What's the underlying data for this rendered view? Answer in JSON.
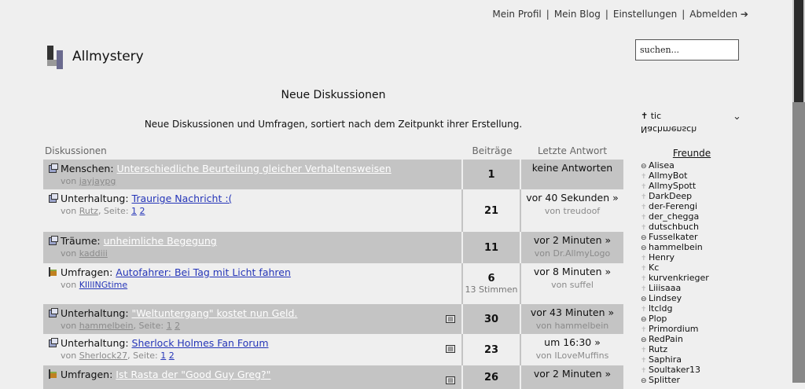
{
  "topnav": {
    "profile": "Mein Profil",
    "blog": "Mein Blog",
    "settings": "Einstellungen",
    "logout": "Abmelden ➔"
  },
  "logo": {
    "text": "Allmystery"
  },
  "search": {
    "value": "suchen..."
  },
  "page": {
    "title": "Neue Diskussionen",
    "description": "Neue Diskussionen und Umfragen, sortiert nach dem Zeitpunkt ihrer Erstellung."
  },
  "table": {
    "headers": {
      "discussions": "Diskussionen",
      "posts": "Beiträge",
      "last_reply": "Letzte Antwort"
    },
    "rows": [
      {
        "type": "topic",
        "category": "Menschen:",
        "title": "Unterschiedliche Beurteilung gleicher Verhaltensweisen",
        "by_prefix": "von",
        "author": "jayjaypg",
        "pages_label": "",
        "pages": [],
        "count": "1",
        "votes": "",
        "last": "keine Antworten",
        "last_by": ""
      },
      {
        "type": "topic",
        "category": "Unterhaltung:",
        "title": "Traurige Nachricht :(",
        "by_prefix": "von",
        "author": "Rutz",
        "pages_label": ", Seite:",
        "pages": [
          "1",
          "2"
        ],
        "count": "21",
        "votes": "",
        "last": "vor 40 Sekunden »",
        "last_by": "von treudoof"
      },
      {
        "type": "topic",
        "category": "Träume:",
        "title": "unheimliche Begegung",
        "by_prefix": "von",
        "author": "kaddiii",
        "pages_label": "",
        "pages": [],
        "count": "11",
        "votes": "",
        "last": "vor 2 Minuten »",
        "last_by": "von Dr.AllmyLogo"
      },
      {
        "type": "poll",
        "category": "Umfragen:",
        "title": "Autofahrer: Bei Tag mit Licht fahren",
        "by_prefix": "von",
        "author": "KIllINGtime",
        "pages_label": "",
        "pages": [],
        "count": "6",
        "votes": "13 Stimmen",
        "last": "vor 8 Minuten »",
        "last_by": "von suffel"
      },
      {
        "type": "topic",
        "category": "Unterhaltung:",
        "title": "\"Weltuntergang\" kostet nun Geld.",
        "by_prefix": "von",
        "author": "hammelbein",
        "pages_label": ", Seite:",
        "pages": [
          "1",
          "2"
        ],
        "count": "30",
        "votes": "",
        "last": "vor 43 Minuten »",
        "last_by": "von hammelbein"
      },
      {
        "type": "topic",
        "category": "Unterhaltung:",
        "title": "Sherlock Holmes Fan Forum",
        "by_prefix": "von",
        "author": "Sherlock27",
        "pages_label": ", Seite:",
        "pages": [
          "1",
          "2"
        ],
        "count": "23",
        "votes": "",
        "last": "um 16:30 »",
        "last_by": "von ILoveMuffins"
      },
      {
        "type": "poll",
        "category": "Umfragen:",
        "title": "Ist Rasta der \"Good Guy Greg?\"",
        "by_prefix": "",
        "author": "",
        "pages_label": "",
        "pages": [],
        "count": "26",
        "votes": "",
        "last": "vor 2 Minuten »",
        "last_by": ""
      }
    ]
  },
  "sidebar": {
    "filter_label": "tic",
    "filter_flipped": "Nachmensch",
    "friends_title": "Freunde",
    "friends": [
      {
        "name": "Alisea",
        "status": "on"
      },
      {
        "name": "AllmyBot",
        "status": "off"
      },
      {
        "name": "AllmySpott",
        "status": "off"
      },
      {
        "name": "DarkDeep",
        "status": "off"
      },
      {
        "name": "der-Ferengi",
        "status": "off"
      },
      {
        "name": "der_chegga",
        "status": "off"
      },
      {
        "name": "dutschbuch",
        "status": "off"
      },
      {
        "name": "Fusselkater",
        "status": "on"
      },
      {
        "name": "hammelbein",
        "status": "on"
      },
      {
        "name": "Henry",
        "status": "off"
      },
      {
        "name": "Kc",
        "status": "off"
      },
      {
        "name": "kurvenkrieger",
        "status": "off"
      },
      {
        "name": "Liiisaaa",
        "status": "off"
      },
      {
        "name": "Lindsey",
        "status": "on"
      },
      {
        "name": "ltcldg",
        "status": "off"
      },
      {
        "name": "Plop",
        "status": "on"
      },
      {
        "name": "Primordium",
        "status": "off"
      },
      {
        "name": "RedPain",
        "status": "on"
      },
      {
        "name": "Rutz",
        "status": "off"
      },
      {
        "name": "Saphira",
        "status": "off"
      },
      {
        "name": "Soultaker13",
        "status": "off"
      },
      {
        "name": "Splitter",
        "status": "on"
      }
    ]
  }
}
